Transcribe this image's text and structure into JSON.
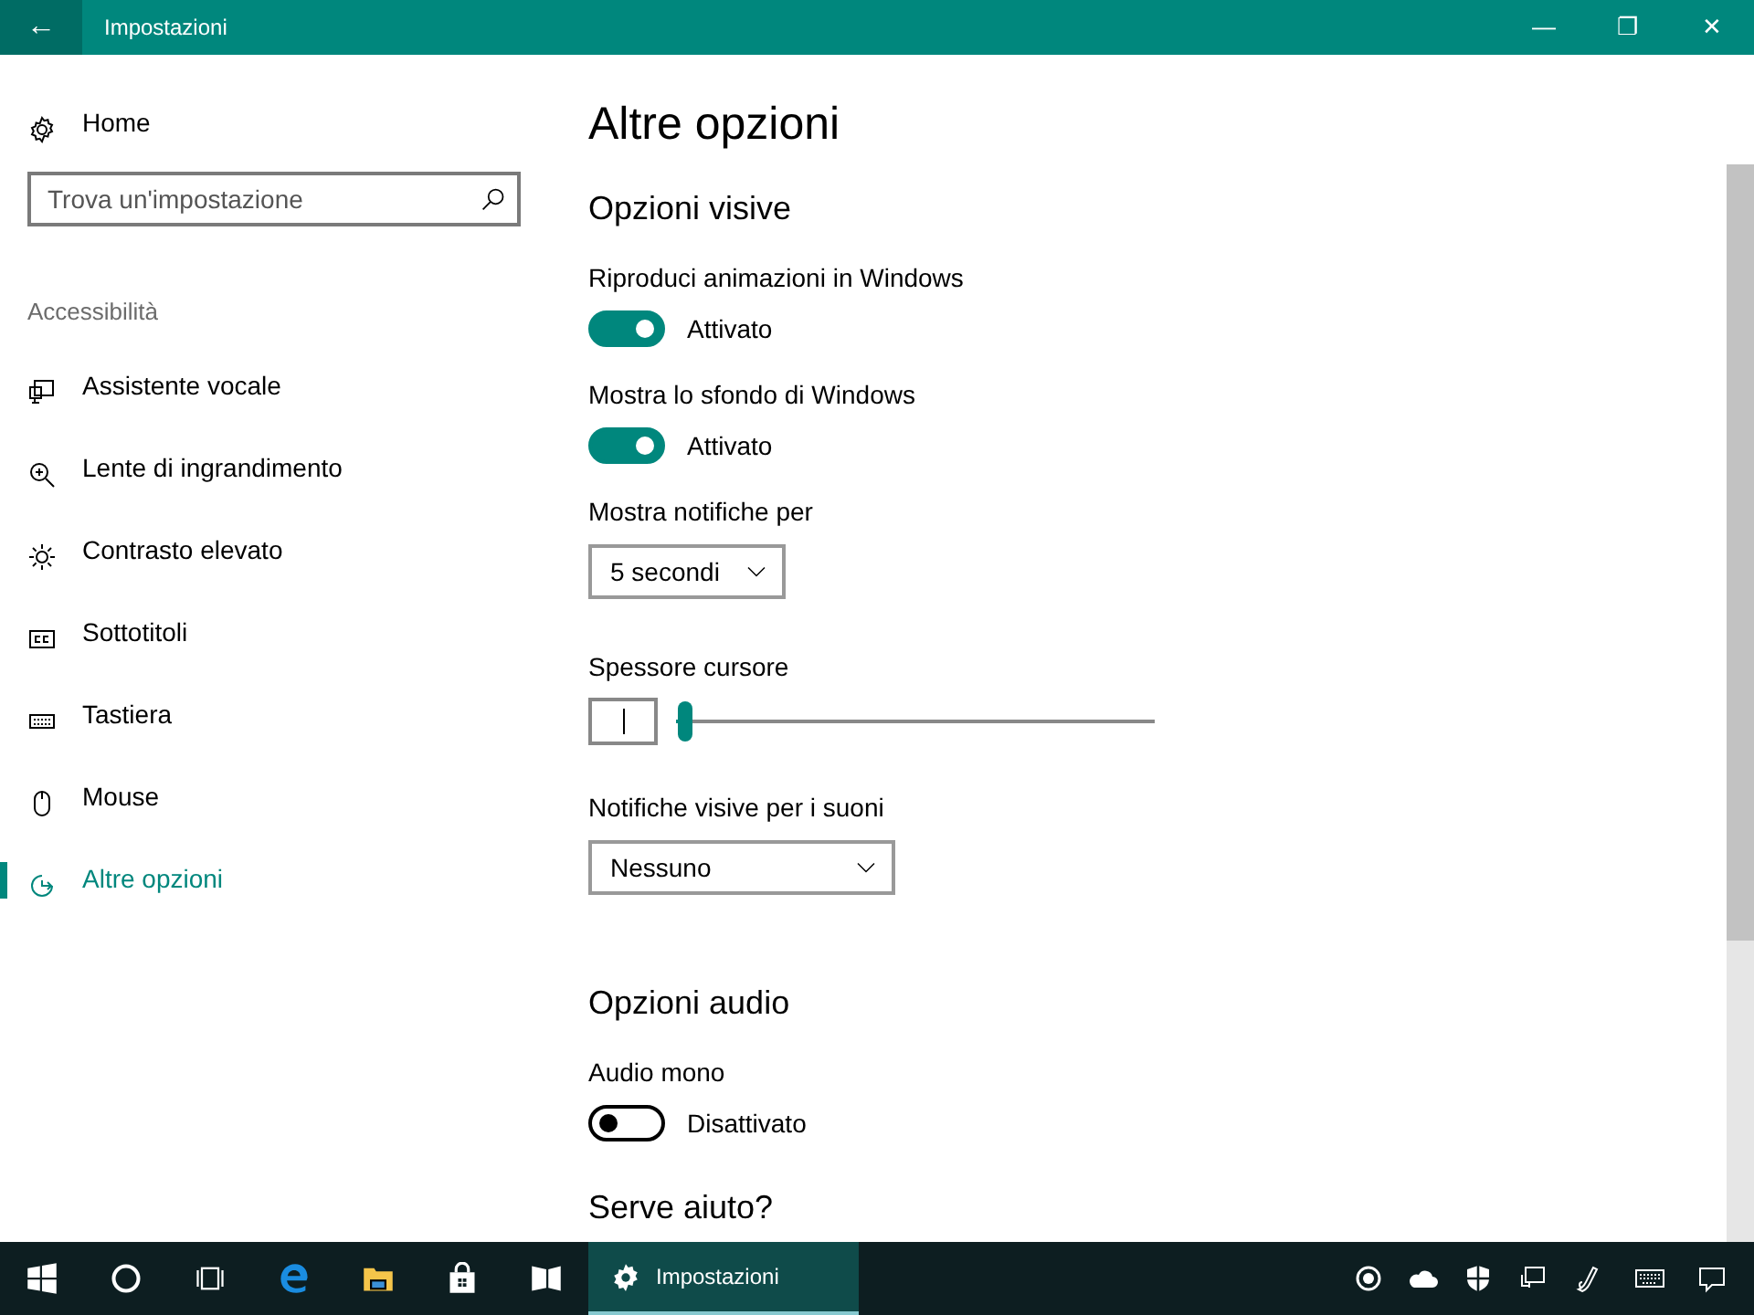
{
  "window": {
    "title": "Impostazioni",
    "back": "←",
    "controls": [
      "—",
      "❐",
      "✕"
    ]
  },
  "sidebar": {
    "home": "Home",
    "search": {
      "placeholder": "Trova un'impostazione"
    },
    "group": "Accessibilità",
    "items": [
      {
        "label": "Assistente vocale",
        "selected": false
      },
      {
        "label": "Lente di ingrandimento",
        "selected": false
      },
      {
        "label": "Contrasto elevato",
        "selected": false
      },
      {
        "label": "Sottotitoli",
        "selected": false
      },
      {
        "label": "Tastiera",
        "selected": false
      },
      {
        "label": "Mouse",
        "selected": false
      },
      {
        "label": "Altre opzioni",
        "selected": true
      }
    ]
  },
  "page": {
    "title": "Altre opzioni",
    "sections": [
      {
        "title": "Opzioni visive",
        "settings": [
          {
            "kind": "toggle",
            "label": "Riproduci animazioni in Windows",
            "on": true,
            "state_text": "Attivato"
          },
          {
            "kind": "toggle",
            "label": "Mostra lo sfondo di Windows",
            "on": true,
            "state_text": "Attivato"
          },
          {
            "kind": "dropdown",
            "label": "Mostra notifiche per",
            "value": "5 secondi"
          },
          {
            "kind": "slider",
            "label": "Spessore cursore",
            "level": 0.02
          },
          {
            "kind": "dropdown",
            "label": "Notifiche visive per i suoni",
            "value": "Nessuno"
          }
        ]
      },
      {
        "title": "Opzioni audio",
        "settings": [
          {
            "kind": "toggle",
            "label": "Audio mono",
            "on": false,
            "state_text": "Disattivato"
          }
        ]
      }
    ],
    "help_title": "Serve aiuto?"
  },
  "taskbar": {
    "open_window": {
      "label": "Impostazioni",
      "selected": true
    }
  }
}
